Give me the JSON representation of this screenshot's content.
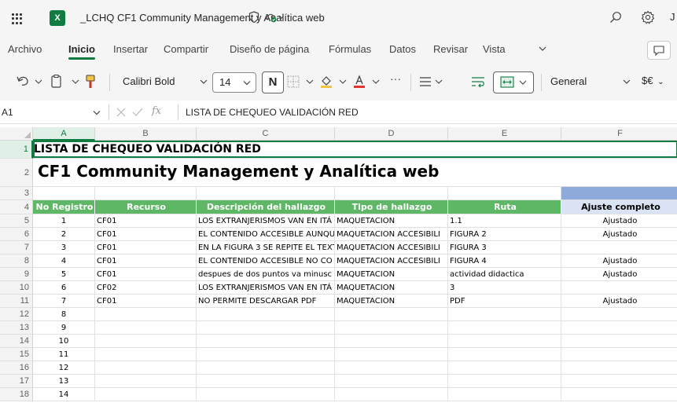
{
  "titlebar": {
    "app_icon_text": "X",
    "doc_title": "_LCHQ CF1 Community Management y Analítica web",
    "user_initial": "J"
  },
  "menu": {
    "tabs": [
      "Archivo",
      "Inicio",
      "Insertar",
      "Compartir",
      "Diseño de página",
      "Fórmulas",
      "Datos",
      "Revisar",
      "Vista"
    ],
    "active_tab": "Inicio"
  },
  "ribbon": {
    "font_name": "Calibri Bold",
    "font_size": "14",
    "bold_label": "N",
    "number_format": "General",
    "currency_label": "$€",
    "more_label": "···"
  },
  "formula_bar": {
    "name_box": "A1",
    "fx_label": "fx",
    "formula": "LISTA DE CHEQUEO VALIDACIÓN RED"
  },
  "sheet": {
    "columns": [
      "A",
      "B",
      "C",
      "D",
      "E",
      "F"
    ],
    "selected_column": "A",
    "rows": [
      "1",
      "2",
      "3",
      "4",
      "5",
      "6",
      "7",
      "8",
      "9",
      "10",
      "11",
      "12",
      "13",
      "14",
      "15",
      "16",
      "17",
      "18"
    ],
    "title_line1": "LISTA DE CHEQUEO VALIDACIÓN RED",
    "title_line2": "CF1 Community Management y Analítica web",
    "headers": [
      "No Registro",
      "Recurso",
      "Descripción del hallazgo",
      "Tipo de hallazgo",
      "Ruta",
      "Ajuste completo"
    ],
    "records": [
      [
        "1",
        "CF01",
        "LOS EXTRANJERISMOS VAN EN ITÁ",
        "MAQUETACION",
        "1.1",
        "Ajustado"
      ],
      [
        "2",
        "CF01",
        "EL CONTENIDO ACCESIBLE AUNQU",
        "MAQUETACION ACCESIBILI",
        "FIGURA 2",
        "Ajustado"
      ],
      [
        "3",
        "CF01",
        "EN LA FIGURA 3 SE REPITE EL TEXT",
        "MAQUETACION ACCESIBILI",
        "FIGURA 3",
        ""
      ],
      [
        "4",
        "CF01",
        "EL CONTENIDO ACCESIBLE NO CO",
        "MAQUETACION ACCESIBILI",
        "FIGURA 4",
        "Ajustado"
      ],
      [
        "5",
        "CF01",
        "despues de dos puntos va minusc",
        "MAQUETACION",
        "actividad didactica",
        "Ajustado"
      ],
      [
        "6",
        "CF02",
        "LOS EXTRANJERISMOS VAN EN ITÁ",
        "MAQUETACION",
        "3",
        ""
      ],
      [
        "7",
        "CF01",
        "NO PERMITE DESCARGAR PDF",
        "MAQUETACION",
        "PDF",
        "Ajustado"
      ],
      [
        "8",
        "",
        "",
        "",
        "",
        ""
      ],
      [
        "9",
        "",
        "",
        "",
        "",
        ""
      ],
      [
        "10",
        "",
        "",
        "",
        "",
        ""
      ],
      [
        "11",
        "",
        "",
        "",
        "",
        ""
      ],
      [
        "12",
        "",
        "",
        "",
        "",
        ""
      ],
      [
        "13",
        "",
        "",
        "",
        "",
        ""
      ],
      [
        "14",
        "",
        "",
        "",
        "",
        ""
      ]
    ]
  },
  "colors": {
    "accent": "#107c41",
    "header_green": "#5db764",
    "header_blue": "#dae3f3",
    "bar_blue": "#8eaadb"
  },
  "icons": [
    "app-launcher-icon",
    "excel-icon",
    "shield-icon",
    "cloud-saved-icon",
    "search-icon",
    "settings-icon",
    "undo-icon",
    "clipboard-icon",
    "format-painter-icon",
    "borders-icon",
    "fill-color-icon",
    "font-color-icon",
    "align-icon",
    "wrap-text-icon",
    "merge-icon",
    "comment-icon"
  ]
}
